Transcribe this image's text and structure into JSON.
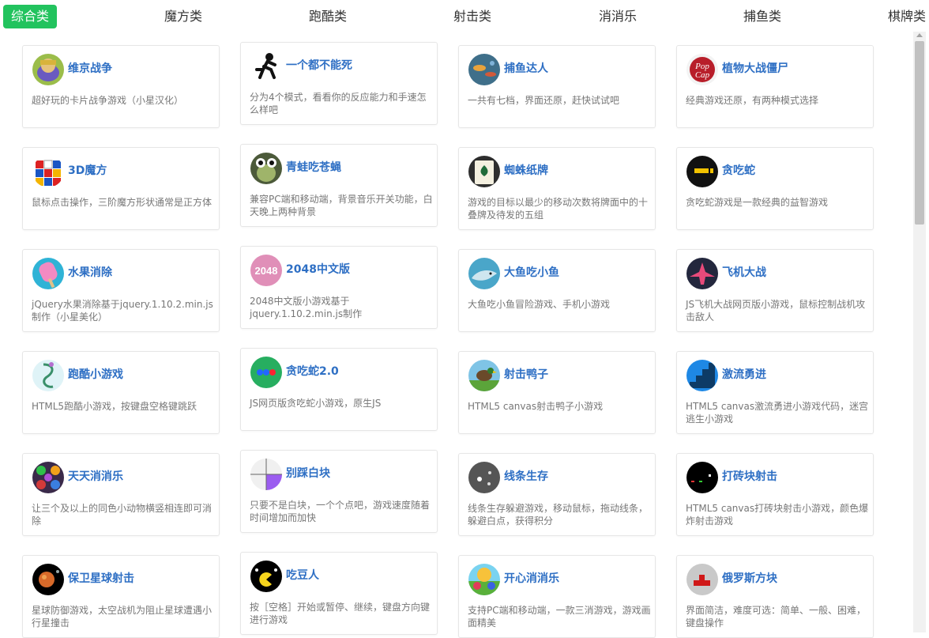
{
  "tabs": [
    {
      "label": "综合类",
      "active": true
    },
    {
      "label": "魔方类"
    },
    {
      "label": "跑酷类"
    },
    {
      "label": "射击类"
    },
    {
      "label": "消消乐"
    },
    {
      "label": "捕鱼类"
    },
    {
      "label": "棋牌类"
    }
  ],
  "colors": {
    "accent": "#22c35e",
    "title": "#2e6fc4"
  },
  "games": [
    {
      "title": "维京战争",
      "desc": "超好玩的卡片战争游戏（小星汉化）",
      "icon": "viking-icon"
    },
    {
      "title": "一个都不能死",
      "desc": "分为4个模式，看看你的反应能力和手速怎么样吧",
      "icon": "runner-icon"
    },
    {
      "title": "捕鱼达人",
      "desc": "一共有七档，界面还原，赶快试试吧",
      "icon": "fish-icon"
    },
    {
      "title": "植物大战僵尸",
      "desc": "经典游戏还原，有两种模式选择",
      "icon": "popcap-icon"
    },
    {
      "title": "3D魔方",
      "desc": "鼠标点击操作，三阶魔方形状通常是正方体",
      "icon": "rubiks-cube-icon"
    },
    {
      "title": "青蛙吃苍蝇",
      "desc": "兼容PC端和移动端，背景音乐开关功能，白天晚上两种背景",
      "icon": "frog-icon"
    },
    {
      "title": "蜘蛛纸牌",
      "desc": "游戏的目标以最少的移动次数将牌面中的十叠牌及待发的五组",
      "icon": "cards-icon"
    },
    {
      "title": "贪吃蛇",
      "desc": "贪吃蛇游戏是一款经典的益智游戏",
      "icon": "snake-icon"
    },
    {
      "title": "水果消除",
      "desc": "jQuery水果消除基于jquery.1.10.2.min.js制作（小星美化）",
      "icon": "popsicle-icon"
    },
    {
      "title": "2048中文版",
      "desc": "2048中文版小游戏基于jquery.1.10.2.min.js制作",
      "icon": "2048-icon",
      "icon_text": "2048"
    },
    {
      "title": "大鱼吃小鱼",
      "desc": "大鱼吃小鱼冒险游戏、手机小游戏",
      "icon": "shark-icon"
    },
    {
      "title": "飞机大战",
      "desc": "JS飞机大战网页版小游戏，鼠标控制战机攻击敌人",
      "icon": "plane-icon"
    },
    {
      "title": "跑酷小游戏",
      "desc": "HTML5跑酷小游戏，按键盘空格键跳跃",
      "icon": "parkour-icon"
    },
    {
      "title": "贪吃蛇2.0",
      "desc": "JS网页版贪吃蛇小游戏，原生JS",
      "icon": "snake2-icon"
    },
    {
      "title": "射击鸭子",
      "desc": "HTML5 canvas射击鸭子小游戏",
      "icon": "duck-icon"
    },
    {
      "title": "激流勇进",
      "desc": "HTML5 canvas激流勇进小游戏代码，迷宫逃生小游戏",
      "icon": "stairs-icon"
    },
    {
      "title": "天天消消乐",
      "desc": "让三个及以上的同色小动物横竖相连即可消除",
      "icon": "animals-icon"
    },
    {
      "title": "别踩白块",
      "desc": "只要不是白块，一个个点吧，游戏速度随着时间增加而加快",
      "icon": "tiles-icon"
    },
    {
      "title": "线条生存",
      "desc": "线条生存躲避游戏，移动鼠标，拖动线条，躲避白点，获得积分",
      "icon": "dots-icon"
    },
    {
      "title": "打砖块射击",
      "desc": "HTML5 canvas打砖块射击小游戏，颜色爆炸射击游戏",
      "icon": "brick-icon"
    },
    {
      "title": "保卫星球射击",
      "desc": "星球防御游戏，太空战机为阻止星球遭遇小行星撞击",
      "icon": "planet-icon"
    },
    {
      "title": "吃豆人",
      "desc": "按［空格］开始或暂停、继续，键盘方向键进行游戏",
      "icon": "pacman-icon"
    },
    {
      "title": "开心消消乐",
      "desc": "支持PC端和移动端，一款三消游戏，游戏画面精美",
      "icon": "happy-match-icon"
    },
    {
      "title": "俄罗斯方块",
      "desc": "界面简洁，难度可选：简单、一般、困难，键盘操作",
      "icon": "tetris-icon"
    }
  ]
}
